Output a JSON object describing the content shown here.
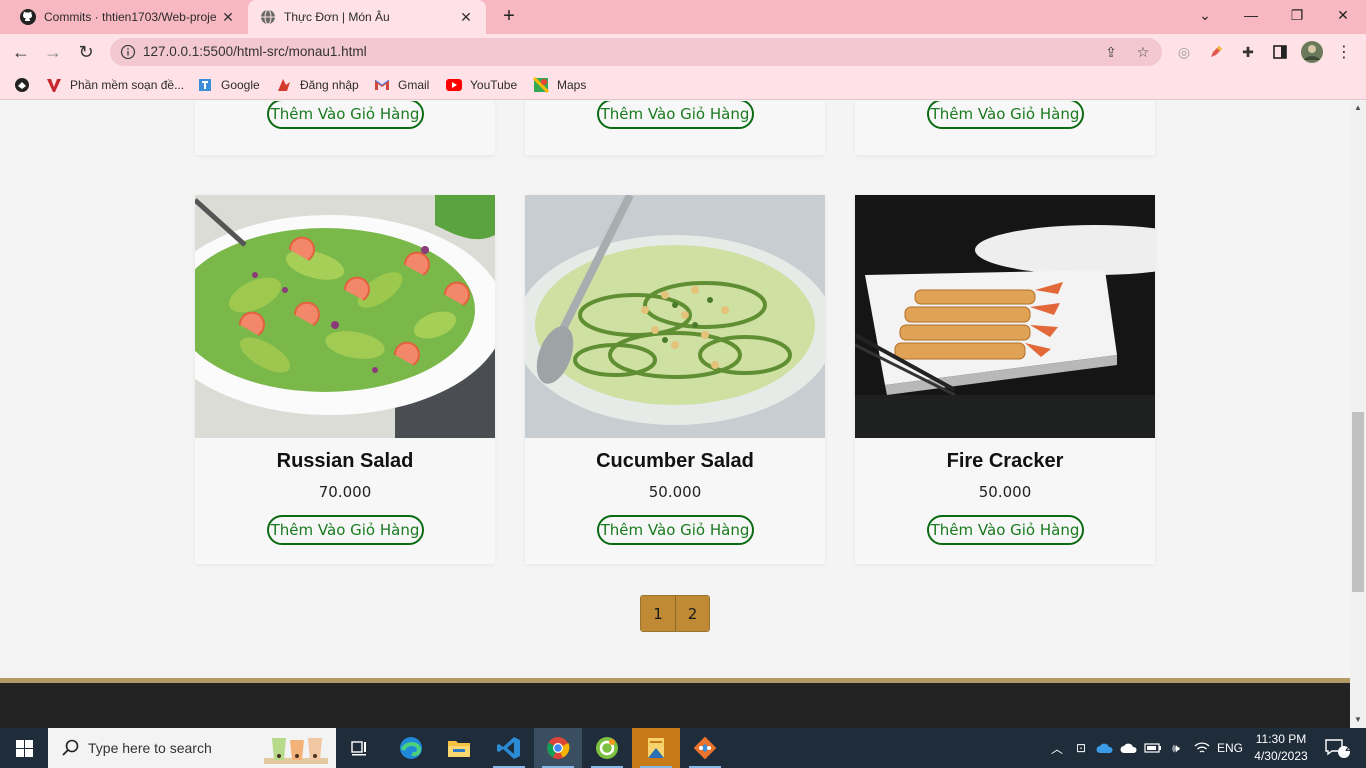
{
  "browser": {
    "tabs": [
      {
        "title": "Commits · thtien1703/Web-proje",
        "active": false,
        "icon": "github-icon"
      },
      {
        "title": "Thực Đơn | Món Âu",
        "active": true,
        "icon": "globe-icon"
      }
    ],
    "url": "127.0.0.1:5500/html-src/monau1.html",
    "bookmarks": [
      {
        "label": "",
        "icon": "site-icon"
      },
      {
        "label": "Phần mềm soạn đề...",
        "icon": "v-logo-icon"
      },
      {
        "label": "Google",
        "icon": "google-icon"
      },
      {
        "label": "Đăng nhập",
        "icon": "login-icon"
      },
      {
        "label": "Gmail",
        "icon": "gmail-icon"
      },
      {
        "label": "YouTube",
        "icon": "youtube-icon"
      },
      {
        "label": "Maps",
        "icon": "maps-icon"
      }
    ],
    "colors": {
      "tabstrip": "#f7b8c2",
      "toolbar": "#ffe2e7"
    }
  },
  "page": {
    "cart_label": "Thêm Vào Giỏ Hàng",
    "products": [
      {
        "name": "Russian Salad",
        "price": "70.000",
        "image": "shrimp-avocado-salad"
      },
      {
        "name": "Cucumber Salad",
        "price": "50.000",
        "image": "cucumber-ribbon-salad"
      },
      {
        "name": "Fire Cracker",
        "price": "50.000",
        "image": "shrimp-spring-rolls"
      }
    ],
    "pagination": [
      "1",
      "2"
    ],
    "colors": {
      "accent_green": "#0b6b12",
      "pager": "#c08a35",
      "footer": "#232323"
    }
  },
  "taskbar": {
    "search_placeholder": "Type here to search",
    "apps": [
      "task-view-icon",
      "edge-icon",
      "file-explorer-icon",
      "vscode-icon",
      "chrome-icon",
      "coccoc-icon",
      "app-orange-icon",
      "git-icon"
    ],
    "language": "ENG",
    "time": "11:30 PM",
    "date": "4/30/2023",
    "notification_count": "2"
  }
}
